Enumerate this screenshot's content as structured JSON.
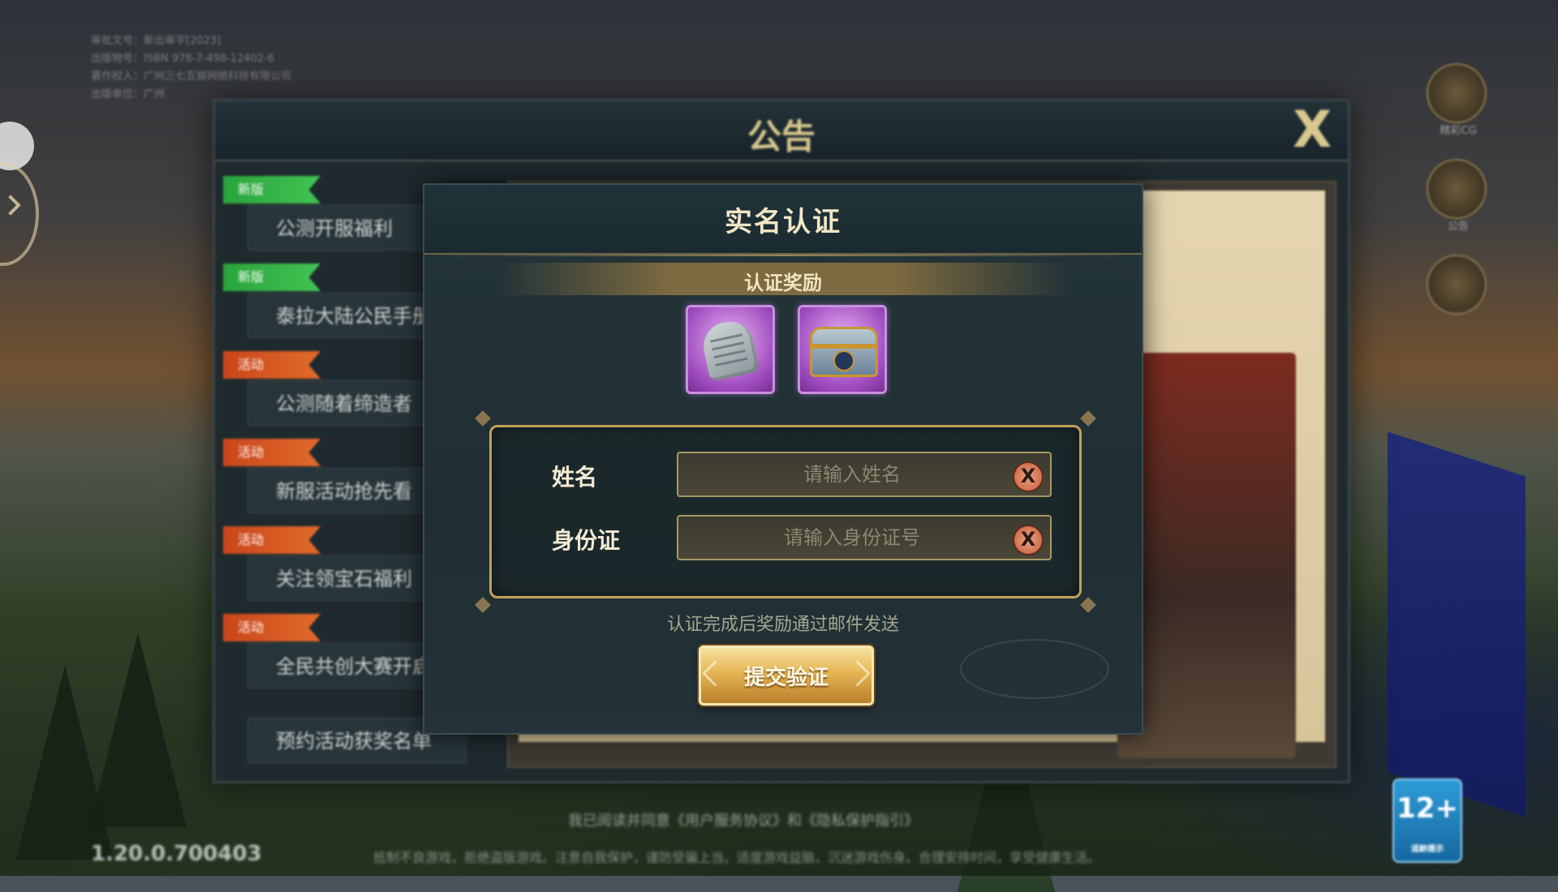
{
  "background": {
    "info_lines": [
      "审批文号：新出审字[2023]",
      "出版物号：ISBN 978-7-498-12402-6",
      "著作权人：广州三七互娱网络科技有限公司",
      "出版单位：广州"
    ],
    "version": "1.20.0.700403",
    "bottom_notice": "抵制不良游戏，拒绝盗版游戏。注意自我保护，谨防受骗上当。适度游戏益脑，沉迷游戏伤身。合理安排时间，享受健康生活。",
    "bottom_check": "我已阅读并同意《用户服务协议》和《隐私保护指引》",
    "right_icons": [
      {
        "label": "精彩CG",
        "icon": "play-icon"
      },
      {
        "label": "公告",
        "icon": "shield-crest-icon"
      },
      {
        "label": "",
        "icon": "character-icon"
      }
    ],
    "age_rating": "12+",
    "age_rating_sub": "适龄提示"
  },
  "announcement": {
    "title": "公告",
    "close": "X",
    "items": [
      {
        "tag": "新版",
        "tag_color": "green",
        "text": "公测开服福利"
      },
      {
        "tag": "新版",
        "tag_color": "green",
        "text": "泰拉大陆公民手册"
      },
      {
        "tag": "活动",
        "tag_color": "orange",
        "text": "公测随着缔造者"
      },
      {
        "tag": "活动",
        "tag_color": "orange",
        "text": "新服活动抢先看"
      },
      {
        "tag": "活动",
        "tag_color": "orange",
        "text": "关注领宝石福利"
      },
      {
        "tag": "活动",
        "tag_color": "orange",
        "text": "全民共创大赛开启"
      },
      {
        "tag": "",
        "tag_color": "",
        "text": "预约活动获奖名单"
      }
    ]
  },
  "dialog": {
    "title": "实名认证",
    "reward_title": "认证奖励",
    "rewards": [
      {
        "icon": "tombstone-icon"
      },
      {
        "icon": "treasure-chest-icon"
      }
    ],
    "fields": {
      "name": {
        "label": "姓名",
        "placeholder": "请输入姓名",
        "value": ""
      },
      "id": {
        "label": "身份证",
        "placeholder": "请输入身份证号",
        "value": ""
      }
    },
    "clear_glyph": "X",
    "hint": "认证完成后奖励通过邮件发送",
    "submit_label": "提交验证"
  },
  "colors": {
    "accent_gold": "#c5a05a",
    "title_text": "#f2e6c6",
    "button_gold": "#e5b552",
    "clear_red": "#c85a36",
    "tag_green": "#2aa33c",
    "tag_orange": "#c9461b"
  }
}
